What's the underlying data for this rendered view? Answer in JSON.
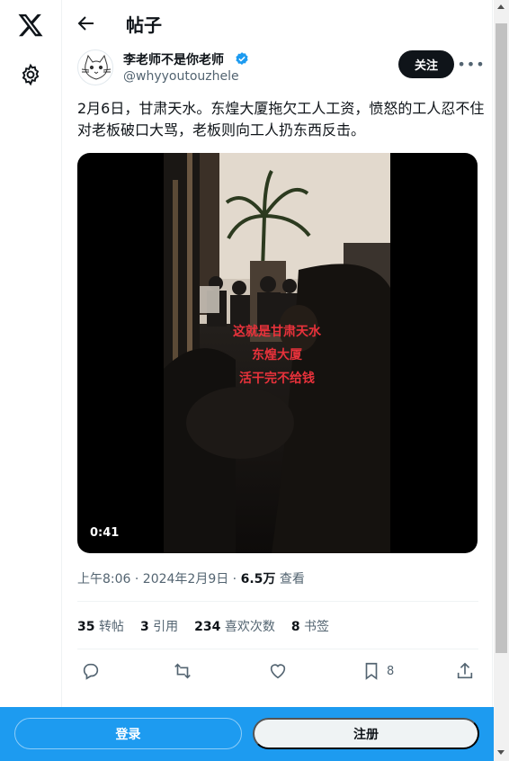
{
  "header": {
    "title": "帖子"
  },
  "author": {
    "name": "李老师不是你老师",
    "handle": "@whyyoutouzhele",
    "follow_label": "关注",
    "verified_color": "#1d9bf0"
  },
  "tweet": {
    "text": "2月6日，甘肃天水。东煌大厦拖欠工人工资，愤怒的工人忍不住对老板破口大骂，老板则向工人扔东西反击。",
    "video": {
      "overlay_lines": [
        "这就是甘肃天水",
        "东煌大厦",
        "活干完不给钱"
      ],
      "duration": "0:41"
    },
    "time": "上午8:06 · 2024年2月9日 · ",
    "views_count": "6.5万",
    "views_label": " 查看"
  },
  "stats": {
    "retweets": "35",
    "retweets_label": "转帖",
    "quotes": "3",
    "quotes_label": "引用",
    "likes": "234",
    "likes_label": "喜欢次数",
    "bookmarks": "8",
    "bookmarks_label": "书签"
  },
  "actions": {
    "bookmark_count": "8"
  },
  "bottom_bar": {
    "login_label": "登录",
    "signup_label": "注册"
  },
  "colors": {
    "accent": "#1d9bf0",
    "text": "#0f1419",
    "muted": "#536471",
    "overlay_text": "#e8323b"
  }
}
